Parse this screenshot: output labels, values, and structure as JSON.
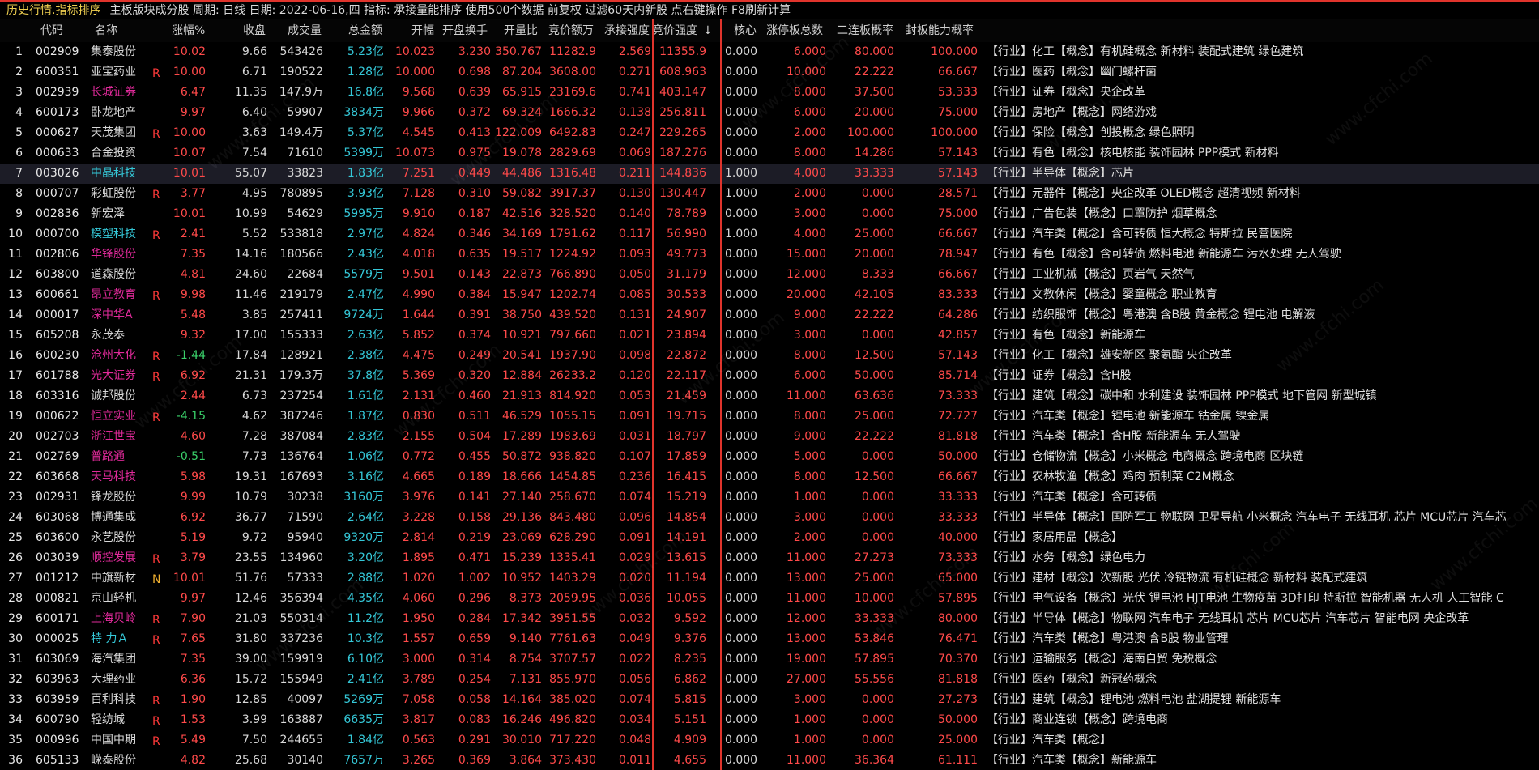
{
  "topbar": {
    "title": "历史行情.指标排序",
    "info": "主板版块成分股 周期: 日线 日期: 2022-06-16,四 指标: 承接量能排序 使用500个数据 前复权 过滤60天内新股 点右键操作 F8刷新计算"
  },
  "headers": {
    "code": "代码",
    "name": "名称",
    "pct": "涨幅%",
    "close": "收盘",
    "vol": "成交量",
    "amount": "总金额",
    "open_pct": "开幅",
    "open_turn": "开盘换手",
    "open_ratio": "开量比",
    "bid_amount": "竞价额万",
    "accept": "承接强度",
    "bid_strength": "竞价强度",
    "bid_sort_mark": "↓",
    "core": "核心",
    "limit_total": "涨停板总数",
    "p2": "二连板概率",
    "seal": "封板能力概率"
  },
  "rows": [
    {
      "idx": "1",
      "code": "002909",
      "name": "集泰股份",
      "nc": "w",
      "flag": "",
      "pct": "10.02",
      "pc": "r",
      "close": "9.66",
      "vol": "543426",
      "amt": "5.23亿",
      "openp": "10.023",
      "turn": "3.230",
      "ratio": "350.767",
      "bid": "11282.9",
      "acc": "2.569",
      "str": "11355.9",
      "core": "0.000",
      "lim": "6.000",
      "p2": "80.000",
      "seal": "100.000",
      "tags": "【行业】化工【概念】有机硅概念 新材料 装配式建筑 绿色建筑"
    },
    {
      "idx": "2",
      "code": "600351",
      "name": "亚宝药业",
      "nc": "w",
      "flag": "R",
      "pct": "10.00",
      "pc": "r",
      "close": "6.71",
      "vol": "190522",
      "amt": "1.28亿",
      "openp": "10.000",
      "turn": "0.698",
      "ratio": "87.204",
      "bid": "3608.00",
      "acc": "0.271",
      "str": "608.963",
      "core": "0.000",
      "lim": "10.000",
      "p2": "22.222",
      "seal": "66.667",
      "tags": "【行业】医药【概念】幽门螺杆菌"
    },
    {
      "idx": "3",
      "code": "002939",
      "name": "长城证券",
      "nc": "m",
      "flag": "",
      "pct": "6.47",
      "pc": "r",
      "close": "11.35",
      "vol": "147.9万",
      "amt": "16.8亿",
      "openp": "9.568",
      "turn": "0.639",
      "ratio": "65.915",
      "bid": "23169.6",
      "acc": "0.741",
      "str": "403.147",
      "core": "0.000",
      "lim": "8.000",
      "p2": "37.500",
      "seal": "53.333",
      "tags": "【行业】证券【概念】央企改革"
    },
    {
      "idx": "4",
      "code": "600173",
      "name": "卧龙地产",
      "nc": "w",
      "flag": "",
      "pct": "9.97",
      "pc": "r",
      "close": "6.40",
      "vol": "59907",
      "amt": "3834万",
      "openp": "9.966",
      "turn": "0.372",
      "ratio": "69.324",
      "bid": "1666.32",
      "acc": "0.138",
      "str": "256.811",
      "core": "0.000",
      "lim": "6.000",
      "p2": "20.000",
      "seal": "75.000",
      "tags": "【行业】房地产【概念】网络游戏"
    },
    {
      "idx": "5",
      "code": "000627",
      "name": "天茂集团",
      "nc": "w",
      "flag": "R",
      "pct": "10.00",
      "pc": "r",
      "close": "3.63",
      "vol": "149.4万",
      "amt": "5.37亿",
      "openp": "4.545",
      "turn": "0.413",
      "ratio": "122.009",
      "bid": "6492.83",
      "acc": "0.247",
      "str": "229.265",
      "core": "0.000",
      "lim": "2.000",
      "p2": "100.000",
      "seal": "100.000",
      "tags": "【行业】保险【概念】创投概念 绿色照明"
    },
    {
      "idx": "6",
      "code": "000633",
      "name": "合金投资",
      "nc": "w",
      "flag": "",
      "pct": "10.07",
      "pc": "r",
      "close": "7.54",
      "vol": "71610",
      "amt": "5399万",
      "openp": "10.073",
      "turn": "0.975",
      "ratio": "19.078",
      "bid": "2829.69",
      "acc": "0.069",
      "str": "187.276",
      "core": "0.000",
      "lim": "8.000",
      "p2": "14.286",
      "seal": "57.143",
      "tags": "【行业】有色【概念】核电核能 装饰园林 PPP模式 新材料"
    },
    {
      "idx": "7",
      "code": "003026",
      "name": "中晶科技",
      "nc": "c",
      "flag": "",
      "pct": "10.01",
      "pc": "r",
      "close": "55.07",
      "vol": "33823",
      "amt": "1.83亿",
      "openp": "7.251",
      "turn": "0.449",
      "ratio": "44.486",
      "bid": "1316.48",
      "acc": "0.211",
      "str": "144.836",
      "core": "1.000",
      "lim": "4.000",
      "p2": "33.333",
      "seal": "57.143",
      "tags": "【行业】半导体【概念】芯片",
      "sel": true
    },
    {
      "idx": "8",
      "code": "000707",
      "name": "彩虹股份",
      "nc": "w",
      "flag": "R",
      "pct": "3.77",
      "pc": "r",
      "close": "4.95",
      "vol": "780895",
      "amt": "3.93亿",
      "openp": "7.128",
      "turn": "0.310",
      "ratio": "59.082",
      "bid": "3917.37",
      "acc": "0.130",
      "str": "130.447",
      "core": "1.000",
      "lim": "2.000",
      "p2": "0.000",
      "seal": "28.571",
      "tags": "【行业】元器件【概念】央企改革 OLED概念 超清视频 新材料"
    },
    {
      "idx": "9",
      "code": "002836",
      "name": "新宏泽",
      "nc": "w",
      "flag": "",
      "pct": "10.01",
      "pc": "r",
      "close": "10.99",
      "vol": "54629",
      "amt": "5995万",
      "openp": "9.910",
      "turn": "0.187",
      "ratio": "42.516",
      "bid": "328.520",
      "acc": "0.140",
      "str": "78.789",
      "core": "0.000",
      "lim": "3.000",
      "p2": "0.000",
      "seal": "75.000",
      "tags": "【行业】广告包装【概念】口罩防护 烟草概念"
    },
    {
      "idx": "10",
      "code": "000700",
      "name": "模塑科技",
      "nc": "c",
      "flag": "R",
      "pct": "2.41",
      "pc": "r",
      "close": "5.52",
      "vol": "533818",
      "amt": "2.97亿",
      "openp": "4.824",
      "turn": "0.346",
      "ratio": "34.169",
      "bid": "1791.62",
      "acc": "0.117",
      "str": "56.990",
      "core": "1.000",
      "lim": "4.000",
      "p2": "25.000",
      "seal": "66.667",
      "tags": "【行业】汽车类【概念】含可转债 恒大概念 特斯拉 民营医院"
    },
    {
      "idx": "11",
      "code": "002806",
      "name": "华锋股份",
      "nc": "m",
      "flag": "",
      "pct": "7.35",
      "pc": "r",
      "close": "14.16",
      "vol": "180566",
      "amt": "2.43亿",
      "openp": "4.018",
      "turn": "0.635",
      "ratio": "19.517",
      "bid": "1224.92",
      "acc": "0.093",
      "str": "49.773",
      "core": "0.000",
      "lim": "15.000",
      "p2": "20.000",
      "seal": "78.947",
      "tags": "【行业】有色【概念】含可转债 燃料电池 新能源车 污水处理 无人驾驶"
    },
    {
      "idx": "12",
      "code": "603800",
      "name": "道森股份",
      "nc": "w",
      "flag": "",
      "pct": "4.81",
      "pc": "r",
      "close": "24.60",
      "vol": "22684",
      "amt": "5579万",
      "openp": "9.501",
      "turn": "0.143",
      "ratio": "22.873",
      "bid": "766.890",
      "acc": "0.050",
      "str": "31.179",
      "core": "0.000",
      "lim": "12.000",
      "p2": "8.333",
      "seal": "66.667",
      "tags": "【行业】工业机械【概念】页岩气 天然气"
    },
    {
      "idx": "13",
      "code": "600661",
      "name": "昂立教育",
      "nc": "m",
      "flag": "R",
      "pct": "9.98",
      "pc": "r",
      "close": "11.46",
      "vol": "219179",
      "amt": "2.47亿",
      "openp": "4.990",
      "turn": "0.384",
      "ratio": "15.947",
      "bid": "1202.74",
      "acc": "0.085",
      "str": "30.533",
      "core": "0.000",
      "lim": "20.000",
      "p2": "42.105",
      "seal": "83.333",
      "tags": "【行业】文教休闲【概念】婴童概念 职业教育"
    },
    {
      "idx": "14",
      "code": "000017",
      "name": "深中华A",
      "nc": "m",
      "flag": "",
      "pct": "5.48",
      "pc": "r",
      "close": "3.85",
      "vol": "257411",
      "amt": "9724万",
      "openp": "1.644",
      "turn": "0.391",
      "ratio": "38.750",
      "bid": "439.520",
      "acc": "0.131",
      "str": "24.907",
      "core": "0.000",
      "lim": "9.000",
      "p2": "22.222",
      "seal": "64.286",
      "tags": "【行业】纺织服饰【概念】粤港澳 含B股 黄金概念 锂电池 电解液"
    },
    {
      "idx": "15",
      "code": "605208",
      "name": "永茂泰",
      "nc": "w",
      "flag": "",
      "pct": "9.32",
      "pc": "r",
      "close": "17.00",
      "vol": "155333",
      "amt": "2.63亿",
      "openp": "5.852",
      "turn": "0.374",
      "ratio": "10.921",
      "bid": "797.660",
      "acc": "0.021",
      "str": "23.894",
      "core": "0.000",
      "lim": "3.000",
      "p2": "0.000",
      "seal": "42.857",
      "tags": "【行业】有色【概念】新能源车"
    },
    {
      "idx": "16",
      "code": "600230",
      "name": "沧州大化",
      "nc": "m",
      "flag": "R",
      "pct": "-1.44",
      "pc": "g",
      "close": "17.84",
      "vol": "128921",
      "amt": "2.38亿",
      "openp": "4.475",
      "turn": "0.249",
      "ratio": "20.541",
      "bid": "1937.90",
      "acc": "0.098",
      "str": "22.872",
      "core": "0.000",
      "lim": "8.000",
      "p2": "12.500",
      "seal": "57.143",
      "tags": "【行业】化工【概念】雄安新区 聚氨酯 央企改革"
    },
    {
      "idx": "17",
      "code": "601788",
      "name": "光大证券",
      "nc": "m",
      "flag": "R",
      "pct": "6.92",
      "pc": "r",
      "close": "21.31",
      "vol": "179.3万",
      "amt": "37.8亿",
      "openp": "5.369",
      "turn": "0.320",
      "ratio": "12.884",
      "bid": "26233.2",
      "acc": "0.120",
      "str": "22.117",
      "core": "0.000",
      "lim": "6.000",
      "p2": "50.000",
      "seal": "85.714",
      "tags": "【行业】证券【概念】含H股"
    },
    {
      "idx": "18",
      "code": "603316",
      "name": "诚邦股份",
      "nc": "w",
      "flag": "",
      "pct": "2.44",
      "pc": "r",
      "close": "6.73",
      "vol": "237254",
      "amt": "1.61亿",
      "openp": "2.131",
      "turn": "0.460",
      "ratio": "21.913",
      "bid": "814.920",
      "acc": "0.053",
      "str": "21.459",
      "core": "0.000",
      "lim": "11.000",
      "p2": "63.636",
      "seal": "73.333",
      "tags": "【行业】建筑【概念】碳中和 水利建设 装饰园林 PPP模式 地下管网 新型城镇"
    },
    {
      "idx": "19",
      "code": "000622",
      "name": "恒立实业",
      "nc": "m",
      "flag": "R",
      "pct": "-4.15",
      "pc": "g",
      "close": "4.62",
      "vol": "387246",
      "amt": "1.87亿",
      "openp": "0.830",
      "turn": "0.511",
      "ratio": "46.529",
      "bid": "1055.15",
      "acc": "0.091",
      "str": "19.715",
      "core": "0.000",
      "lim": "8.000",
      "p2": "25.000",
      "seal": "72.727",
      "tags": "【行业】汽车类【概念】锂电池 新能源车 钴金属 镍金属"
    },
    {
      "idx": "20",
      "code": "002703",
      "name": "浙江世宝",
      "nc": "m",
      "flag": "",
      "pct": "4.60",
      "pc": "r",
      "close": "7.28",
      "vol": "387084",
      "amt": "2.83亿",
      "openp": "2.155",
      "turn": "0.504",
      "ratio": "17.289",
      "bid": "1983.69",
      "acc": "0.031",
      "str": "18.797",
      "core": "0.000",
      "lim": "9.000",
      "p2": "22.222",
      "seal": "81.818",
      "tags": "【行业】汽车类【概念】含H股 新能源车 无人驾驶"
    },
    {
      "idx": "21",
      "code": "002769",
      "name": "普路通",
      "nc": "m",
      "flag": "",
      "pct": "-0.51",
      "pc": "g",
      "close": "7.73",
      "vol": "136764",
      "amt": "1.06亿",
      "openp": "0.772",
      "turn": "0.455",
      "ratio": "50.872",
      "bid": "938.820",
      "acc": "0.107",
      "str": "17.859",
      "core": "0.000",
      "lim": "5.000",
      "p2": "0.000",
      "seal": "50.000",
      "tags": "【行业】仓储物流【概念】小米概念 电商概念 跨境电商 区块链"
    },
    {
      "idx": "22",
      "code": "603668",
      "name": "天马科技",
      "nc": "m",
      "flag": "",
      "pct": "5.98",
      "pc": "r",
      "close": "19.31",
      "vol": "167693",
      "amt": "3.16亿",
      "openp": "4.665",
      "turn": "0.189",
      "ratio": "18.666",
      "bid": "1454.85",
      "acc": "0.236",
      "str": "16.415",
      "core": "0.000",
      "lim": "8.000",
      "p2": "12.500",
      "seal": "66.667",
      "tags": "【行业】农林牧渔【概念】鸡肉 预制菜 C2M概念"
    },
    {
      "idx": "23",
      "code": "002931",
      "name": "锋龙股份",
      "nc": "w",
      "flag": "",
      "pct": "9.99",
      "pc": "r",
      "close": "10.79",
      "vol": "30238",
      "amt": "3160万",
      "openp": "3.976",
      "turn": "0.141",
      "ratio": "27.140",
      "bid": "258.670",
      "acc": "0.074",
      "str": "15.219",
      "core": "0.000",
      "lim": "1.000",
      "p2": "0.000",
      "seal": "33.333",
      "tags": "【行业】汽车类【概念】含可转债"
    },
    {
      "idx": "24",
      "code": "603068",
      "name": "博通集成",
      "nc": "w",
      "flag": "",
      "pct": "6.92",
      "pc": "r",
      "close": "36.77",
      "vol": "71590",
      "amt": "2.64亿",
      "openp": "3.228",
      "turn": "0.158",
      "ratio": "29.136",
      "bid": "843.480",
      "acc": "0.096",
      "str": "14.854",
      "core": "0.000",
      "lim": "3.000",
      "p2": "0.000",
      "seal": "33.333",
      "tags": "【行业】半导体【概念】国防军工 物联网 卫星导航 小米概念 汽车电子 无线耳机 芯片 MCU芯片 汽车芯"
    },
    {
      "idx": "25",
      "code": "603600",
      "name": "永艺股份",
      "nc": "w",
      "flag": "",
      "pct": "5.19",
      "pc": "r",
      "close": "9.72",
      "vol": "95940",
      "amt": "9320万",
      "openp": "2.814",
      "turn": "0.219",
      "ratio": "23.069",
      "bid": "628.290",
      "acc": "0.091",
      "str": "14.191",
      "core": "0.000",
      "lim": "2.000",
      "p2": "0.000",
      "seal": "40.000",
      "tags": "【行业】家居用品【概念】"
    },
    {
      "idx": "26",
      "code": "003039",
      "name": "顺控发展",
      "nc": "m",
      "flag": "R",
      "pct": "3.79",
      "pc": "r",
      "close": "23.55",
      "vol": "134960",
      "amt": "3.20亿",
      "openp": "1.895",
      "turn": "0.471",
      "ratio": "15.239",
      "bid": "1335.41",
      "acc": "0.029",
      "str": "13.615",
      "core": "0.000",
      "lim": "11.000",
      "p2": "27.273",
      "seal": "73.333",
      "tags": "【行业】水务【概念】绿色电力"
    },
    {
      "idx": "27",
      "code": "001212",
      "name": "中旗新材",
      "nc": "w",
      "flag": "N",
      "pct": "10.01",
      "pc": "r",
      "close": "51.76",
      "vol": "57333",
      "amt": "2.88亿",
      "openp": "1.020",
      "turn": "1.002",
      "ratio": "10.952",
      "bid": "1403.29",
      "acc": "0.020",
      "str": "11.194",
      "core": "0.000",
      "lim": "13.000",
      "p2": "25.000",
      "seal": "65.000",
      "tags": "【行业】建材【概念】次新股 光伏 冷链物流 有机硅概念 新材料 装配式建筑"
    },
    {
      "idx": "28",
      "code": "000821",
      "name": "京山轻机",
      "nc": "w",
      "flag": "",
      "pct": "9.97",
      "pc": "r",
      "close": "12.46",
      "vol": "356394",
      "amt": "4.35亿",
      "openp": "4.060",
      "turn": "0.296",
      "ratio": "8.373",
      "bid": "2059.95",
      "acc": "0.036",
      "str": "10.055",
      "core": "0.000",
      "lim": "11.000",
      "p2": "10.000",
      "seal": "57.895",
      "tags": "【行业】电气设备【概念】光伏 锂电池 HJT电池 生物疫苗 3D打印 特斯拉 智能机器 无人机 人工智能 C"
    },
    {
      "idx": "29",
      "code": "600171",
      "name": "上海贝岭",
      "nc": "m",
      "flag": "R",
      "pct": "7.90",
      "pc": "r",
      "close": "21.03",
      "vol": "550314",
      "amt": "11.2亿",
      "openp": "1.950",
      "turn": "0.284",
      "ratio": "17.342",
      "bid": "3951.55",
      "acc": "0.032",
      "str": "9.592",
      "core": "0.000",
      "lim": "12.000",
      "p2": "33.333",
      "seal": "80.000",
      "tags": "【行业】半导体【概念】物联网 汽车电子 无线耳机 芯片 MCU芯片 汽车芯片 智能电网 央企改革"
    },
    {
      "idx": "30",
      "code": "000025",
      "name": "特 力Ａ",
      "nc": "c",
      "flag": "R",
      "pct": "7.65",
      "pc": "r",
      "close": "31.80",
      "vol": "337236",
      "amt": "10.3亿",
      "openp": "1.557",
      "turn": "0.659",
      "ratio": "9.140",
      "bid": "7761.63",
      "acc": "0.049",
      "str": "9.376",
      "core": "0.000",
      "lim": "13.000",
      "p2": "53.846",
      "seal": "76.471",
      "tags": "【行业】汽车类【概念】粤港澳 含B股 物业管理"
    },
    {
      "idx": "31",
      "code": "603069",
      "name": "海汽集团",
      "nc": "w",
      "flag": "",
      "pct": "7.35",
      "pc": "r",
      "close": "39.00",
      "vol": "159919",
      "amt": "6.10亿",
      "openp": "3.000",
      "turn": "0.314",
      "ratio": "8.754",
      "bid": "3707.57",
      "acc": "0.022",
      "str": "8.235",
      "core": "0.000",
      "lim": "19.000",
      "p2": "57.895",
      "seal": "70.370",
      "tags": "【行业】运输服务【概念】海南自贸 免税概念"
    },
    {
      "idx": "32",
      "code": "603963",
      "name": "大理药业",
      "nc": "w",
      "flag": "",
      "pct": "6.36",
      "pc": "r",
      "close": "15.72",
      "vol": "155949",
      "amt": "2.41亿",
      "openp": "3.789",
      "turn": "0.254",
      "ratio": "7.131",
      "bid": "855.970",
      "acc": "0.056",
      "str": "6.862",
      "core": "0.000",
      "lim": "27.000",
      "p2": "55.556",
      "seal": "81.818",
      "tags": "【行业】医药【概念】新冠药概念"
    },
    {
      "idx": "33",
      "code": "603959",
      "name": "百利科技",
      "nc": "w",
      "flag": "R",
      "pct": "1.90",
      "pc": "r",
      "close": "12.85",
      "vol": "40097",
      "amt": "5269万",
      "openp": "7.058",
      "turn": "0.058",
      "ratio": "14.164",
      "bid": "385.020",
      "acc": "0.074",
      "str": "5.815",
      "core": "0.000",
      "lim": "3.000",
      "p2": "0.000",
      "seal": "27.273",
      "tags": "【行业】建筑【概念】锂电池 燃料电池 盐湖提锂 新能源车"
    },
    {
      "idx": "34",
      "code": "600790",
      "name": "轻纺城",
      "nc": "w",
      "flag": "R",
      "pct": "1.53",
      "pc": "r",
      "close": "3.99",
      "vol": "163887",
      "amt": "6635万",
      "openp": "3.817",
      "turn": "0.083",
      "ratio": "16.246",
      "bid": "496.820",
      "acc": "0.034",
      "str": "5.151",
      "core": "0.000",
      "lim": "1.000",
      "p2": "0.000",
      "seal": "50.000",
      "tags": "【行业】商业连锁【概念】跨境电商"
    },
    {
      "idx": "35",
      "code": "000996",
      "name": "中国中期",
      "nc": "w",
      "flag": "R",
      "pct": "5.49",
      "pc": "r",
      "close": "7.50",
      "vol": "244655",
      "amt": "1.84亿",
      "openp": "0.563",
      "turn": "0.291",
      "ratio": "30.010",
      "bid": "717.220",
      "acc": "0.048",
      "str": "4.909",
      "core": "0.000",
      "lim": "1.000",
      "p2": "0.000",
      "seal": "25.000",
      "tags": "【行业】汽车类【概念】"
    },
    {
      "idx": "36",
      "code": "605133",
      "name": "嵘泰股份",
      "nc": "w",
      "flag": "",
      "pct": "4.82",
      "pc": "r",
      "close": "25.68",
      "vol": "30140",
      "amt": "7657万",
      "openp": "3.265",
      "turn": "0.369",
      "ratio": "3.864",
      "bid": "373.430",
      "acc": "0.011",
      "str": "4.655",
      "core": "0.000",
      "lim": "11.000",
      "p2": "36.364",
      "seal": "61.111",
      "tags": "【行业】汽车类【概念】新能源车"
    }
  ],
  "watermark": "www.cfchi.com"
}
